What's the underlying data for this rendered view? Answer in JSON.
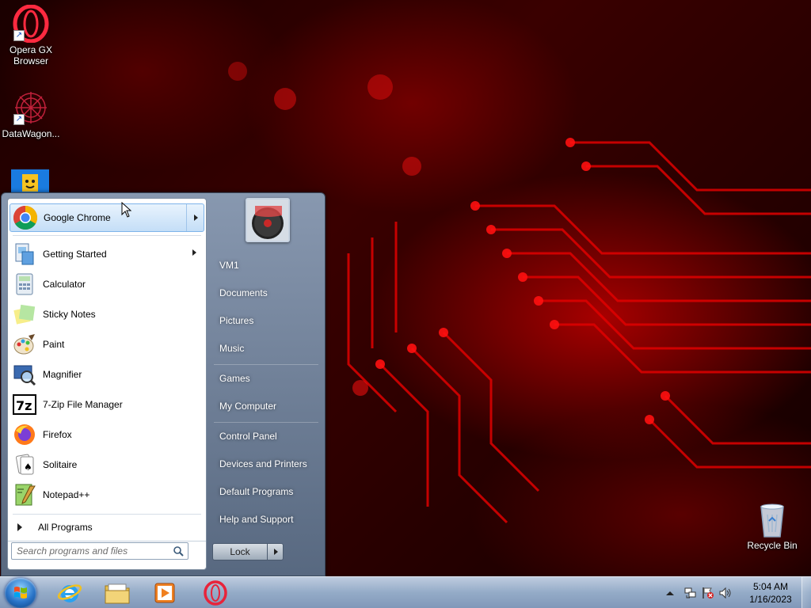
{
  "desktop": {
    "icons": [
      {
        "label_line1": "Opera GX",
        "label_line2": "Browser",
        "icon": "opera-gx-icon"
      },
      {
        "label_line1": "DataWagon...",
        "label_line2": "",
        "icon": "datawagon-icon"
      },
      {
        "label_line1": "Recycle Bin",
        "label_line2": "",
        "icon": "recycle-bin-icon"
      }
    ]
  },
  "start_menu": {
    "pinned": {
      "label": "Google Chrome",
      "icon": "chrome-icon"
    },
    "programs": [
      {
        "label": "Getting Started",
        "icon": "getting-started-icon",
        "has_submenu": true
      },
      {
        "label": "Calculator",
        "icon": "calculator-icon"
      },
      {
        "label": "Sticky Notes",
        "icon": "sticky-notes-icon"
      },
      {
        "label": "Paint",
        "icon": "paint-icon"
      },
      {
        "label": "Magnifier",
        "icon": "magnifier-icon"
      },
      {
        "label": "7-Zip File Manager",
        "icon": "7zip-icon"
      },
      {
        "label": "Firefox",
        "icon": "firefox-icon"
      },
      {
        "label": "Solitaire",
        "icon": "solitaire-icon"
      },
      {
        "label": "Notepad++",
        "icon": "notepadpp-icon"
      }
    ],
    "all_programs_label": "All Programs",
    "search_placeholder": "Search programs and files",
    "right_pane": {
      "user_name": "VM1",
      "items": [
        "Documents",
        "Pictures",
        "Music",
        "Games",
        "My Computer",
        "Control Panel",
        "Devices and Printers",
        "Default Programs",
        "Help and Support"
      ]
    },
    "lock_label": "Lock"
  },
  "taskbar": {
    "pinned": [
      "internet-explorer-icon",
      "file-explorer-icon",
      "media-player-icon",
      "opera-taskbar-icon"
    ],
    "clock_time": "5:04 AM",
    "clock_date": "1/16/2023"
  },
  "colors": {
    "wallpaper_accent": "#d00000",
    "start_menu_frame": "#7f95ad",
    "taskbar": "#9fb6d3",
    "highlight": "#c4def7"
  }
}
